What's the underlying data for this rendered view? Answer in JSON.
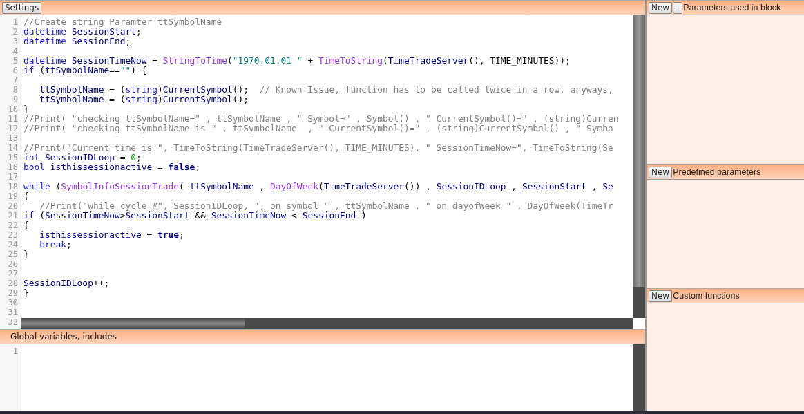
{
  "toolbar": {
    "settings_button": "Settings"
  },
  "main_editor": {
    "lines": [
      {
        "number": "1",
        "tokens": [
          {
            "kind": "comment",
            "text": "//Create string Paramter ttSymbolName"
          }
        ]
      },
      {
        "number": "2",
        "tokens": [
          {
            "kind": "type",
            "text": "datetime"
          },
          {
            "kind": "ident",
            "text": " SessionStart"
          },
          {
            "kind": "plain",
            "text": ";"
          }
        ]
      },
      {
        "number": "3",
        "tokens": [
          {
            "kind": "type",
            "text": "datetime"
          },
          {
            "kind": "ident",
            "text": " SessionEnd"
          },
          {
            "kind": "plain",
            "text": ";"
          }
        ]
      },
      {
        "number": "4"
      },
      {
        "number": "5",
        "tokens": [
          {
            "kind": "type",
            "text": "datetime"
          },
          {
            "kind": "ident",
            "text": " SessionTimeNow"
          },
          {
            "kind": "plain",
            "text": " = "
          },
          {
            "kind": "func",
            "text": "StringToTime"
          },
          {
            "kind": "plain",
            "text": "("
          },
          {
            "kind": "string",
            "text": "\"1970.01.01 \""
          },
          {
            "kind": "plain",
            "text": " + "
          },
          {
            "kind": "func",
            "text": "TimeToString"
          },
          {
            "kind": "plain",
            "text": "("
          },
          {
            "kind": "ident",
            "text": "TimeTradeServer"
          },
          {
            "kind": "plain",
            "text": "(), TIME_MINUTES));"
          }
        ]
      },
      {
        "number": "6",
        "tokens": [
          {
            "kind": "type",
            "text": "if"
          },
          {
            "kind": "plain",
            "text": " ("
          },
          {
            "kind": "ident",
            "text": "ttSymbolName"
          },
          {
            "kind": "plain",
            "text": "=="
          },
          {
            "kind": "string",
            "text": "\"\""
          },
          {
            "kind": "plain",
            "text": ") {"
          }
        ]
      },
      {
        "number": "7"
      },
      {
        "number": "8",
        "tokens": [
          {
            "kind": "ident",
            "text": "   ttSymbolName"
          },
          {
            "kind": "plain",
            "text": " = ("
          },
          {
            "kind": "type",
            "text": "string"
          },
          {
            "kind": "plain",
            "text": ")"
          },
          {
            "kind": "ident",
            "text": "CurrentSymbol"
          },
          {
            "kind": "plain",
            "text": "();  "
          },
          {
            "kind": "comment",
            "text": "// Known Issue, function has to be called twice in a row, anyways,"
          }
        ]
      },
      {
        "number": "9",
        "tokens": [
          {
            "kind": "ident",
            "text": "   ttSymbolName"
          },
          {
            "kind": "plain",
            "text": " = ("
          },
          {
            "kind": "type",
            "text": "string"
          },
          {
            "kind": "plain",
            "text": ")"
          },
          {
            "kind": "ident",
            "text": "CurrentSymbol"
          },
          {
            "kind": "plain",
            "text": "();"
          }
        ]
      },
      {
        "number": "10",
        "tokens": [
          {
            "kind": "plain",
            "text": "}"
          }
        ]
      },
      {
        "number": "11",
        "tokens": [
          {
            "kind": "comment",
            "text": "//Print( \"checking ttSymbolName=\" , ttSymbolName , \" Symbol=\" , Symbol() , \" CurrentSymbol()=\" , (string)Curren"
          }
        ]
      },
      {
        "number": "12",
        "tokens": [
          {
            "kind": "comment",
            "text": "//Print( \"checking ttSymbolName is \" , ttSymbolName  , \" CurrentSymbol()=\" , (string)CurrentSymbol() , \" Symbo"
          }
        ]
      },
      {
        "number": "13"
      },
      {
        "number": "14",
        "tokens": [
          {
            "kind": "comment",
            "text": "//Print(\"Current time is \", TimeToString(TimeTradeServer(), TIME_MINUTES), \" SessionTimeNow=\", TimeToString(Se"
          }
        ]
      },
      {
        "number": "15",
        "tokens": [
          {
            "kind": "type",
            "text": "int"
          },
          {
            "kind": "ident",
            "text": " SessionIDLoop"
          },
          {
            "kind": "plain",
            "text": " = "
          },
          {
            "kind": "number",
            "text": "0"
          },
          {
            "kind": "plain",
            "text": ";"
          }
        ]
      },
      {
        "number": "16",
        "tokens": [
          {
            "kind": "type",
            "text": "bool"
          },
          {
            "kind": "ident",
            "text": " isthissessionactive"
          },
          {
            "kind": "plain",
            "text": " = "
          },
          {
            "kind": "const",
            "text": "false"
          },
          {
            "kind": "plain",
            "text": ";"
          }
        ]
      },
      {
        "number": "17"
      },
      {
        "number": "18",
        "tokens": [
          {
            "kind": "type",
            "text": "while"
          },
          {
            "kind": "plain",
            "text": " ("
          },
          {
            "kind": "func",
            "text": "SymbolInfoSessionTrade"
          },
          {
            "kind": "plain",
            "text": "( "
          },
          {
            "kind": "ident",
            "text": "ttSymbolName"
          },
          {
            "kind": "plain",
            "text": " , "
          },
          {
            "kind": "func",
            "text": "DayOfWeek"
          },
          {
            "kind": "plain",
            "text": "("
          },
          {
            "kind": "ident",
            "text": "TimeTradeServer"
          },
          {
            "kind": "plain",
            "text": "()) , "
          },
          {
            "kind": "ident",
            "text": "SessionIDLoop"
          },
          {
            "kind": "plain",
            "text": " , "
          },
          {
            "kind": "ident",
            "text": "SessionStart"
          },
          {
            "kind": "plain",
            "text": " , "
          },
          {
            "kind": "ident",
            "text": "Se"
          }
        ]
      },
      {
        "number": "19",
        "tokens": [
          {
            "kind": "plain",
            "text": "{"
          }
        ]
      },
      {
        "number": "20",
        "tokens": [
          {
            "kind": "comment",
            "text": "   //Print(\"while cycle #\", SessionIDLoop, \", on symbol \" , ttSymbolName , \" on dayofWeek \" , DayOfWeek(TimeTr"
          }
        ]
      },
      {
        "number": "21",
        "tokens": [
          {
            "kind": "type",
            "text": "if"
          },
          {
            "kind": "plain",
            "text": " ("
          },
          {
            "kind": "ident",
            "text": "SessionTimeNow"
          },
          {
            "kind": "plain",
            "text": ">"
          },
          {
            "kind": "ident",
            "text": "SessionStart"
          },
          {
            "kind": "plain",
            "text": " && "
          },
          {
            "kind": "ident",
            "text": "SessionTimeNow"
          },
          {
            "kind": "plain",
            "text": " < "
          },
          {
            "kind": "ident",
            "text": "SessionEnd"
          },
          {
            "kind": "plain",
            "text": " )"
          }
        ]
      },
      {
        "number": "22",
        "tokens": [
          {
            "kind": "plain",
            "text": "{"
          }
        ]
      },
      {
        "number": "23",
        "tokens": [
          {
            "kind": "ident",
            "text": "   isthissessionactive"
          },
          {
            "kind": "plain",
            "text": " = "
          },
          {
            "kind": "const",
            "text": "true"
          },
          {
            "kind": "plain",
            "text": ";"
          }
        ]
      },
      {
        "number": "24",
        "tokens": [
          {
            "kind": "type",
            "text": "   break"
          },
          {
            "kind": "plain",
            "text": ";"
          }
        ]
      },
      {
        "number": "25",
        "tokens": [
          {
            "kind": "plain",
            "text": "}"
          }
        ]
      },
      {
        "number": "26"
      },
      {
        "number": "27"
      },
      {
        "number": "28",
        "tokens": [
          {
            "kind": "ident",
            "text": "SessionIDLoop"
          },
          {
            "kind": "plain",
            "text": "++;"
          }
        ]
      },
      {
        "number": "29",
        "tokens": [
          {
            "kind": "plain",
            "text": "}"
          }
        ]
      },
      {
        "number": "30"
      },
      {
        "number": "31"
      },
      {
        "number": "32"
      }
    ]
  },
  "globals_panel": {
    "title": "Global variables, includes",
    "lines": [
      {
        "number": "1"
      }
    ]
  },
  "side_sections": [
    {
      "title": "Parameters used in block",
      "buttons": [
        "New",
        "–"
      ]
    },
    {
      "title": "Predefined parameters",
      "buttons": [
        "New"
      ]
    },
    {
      "title": "Custom functions",
      "buttons": [
        "New"
      ]
    }
  ]
}
